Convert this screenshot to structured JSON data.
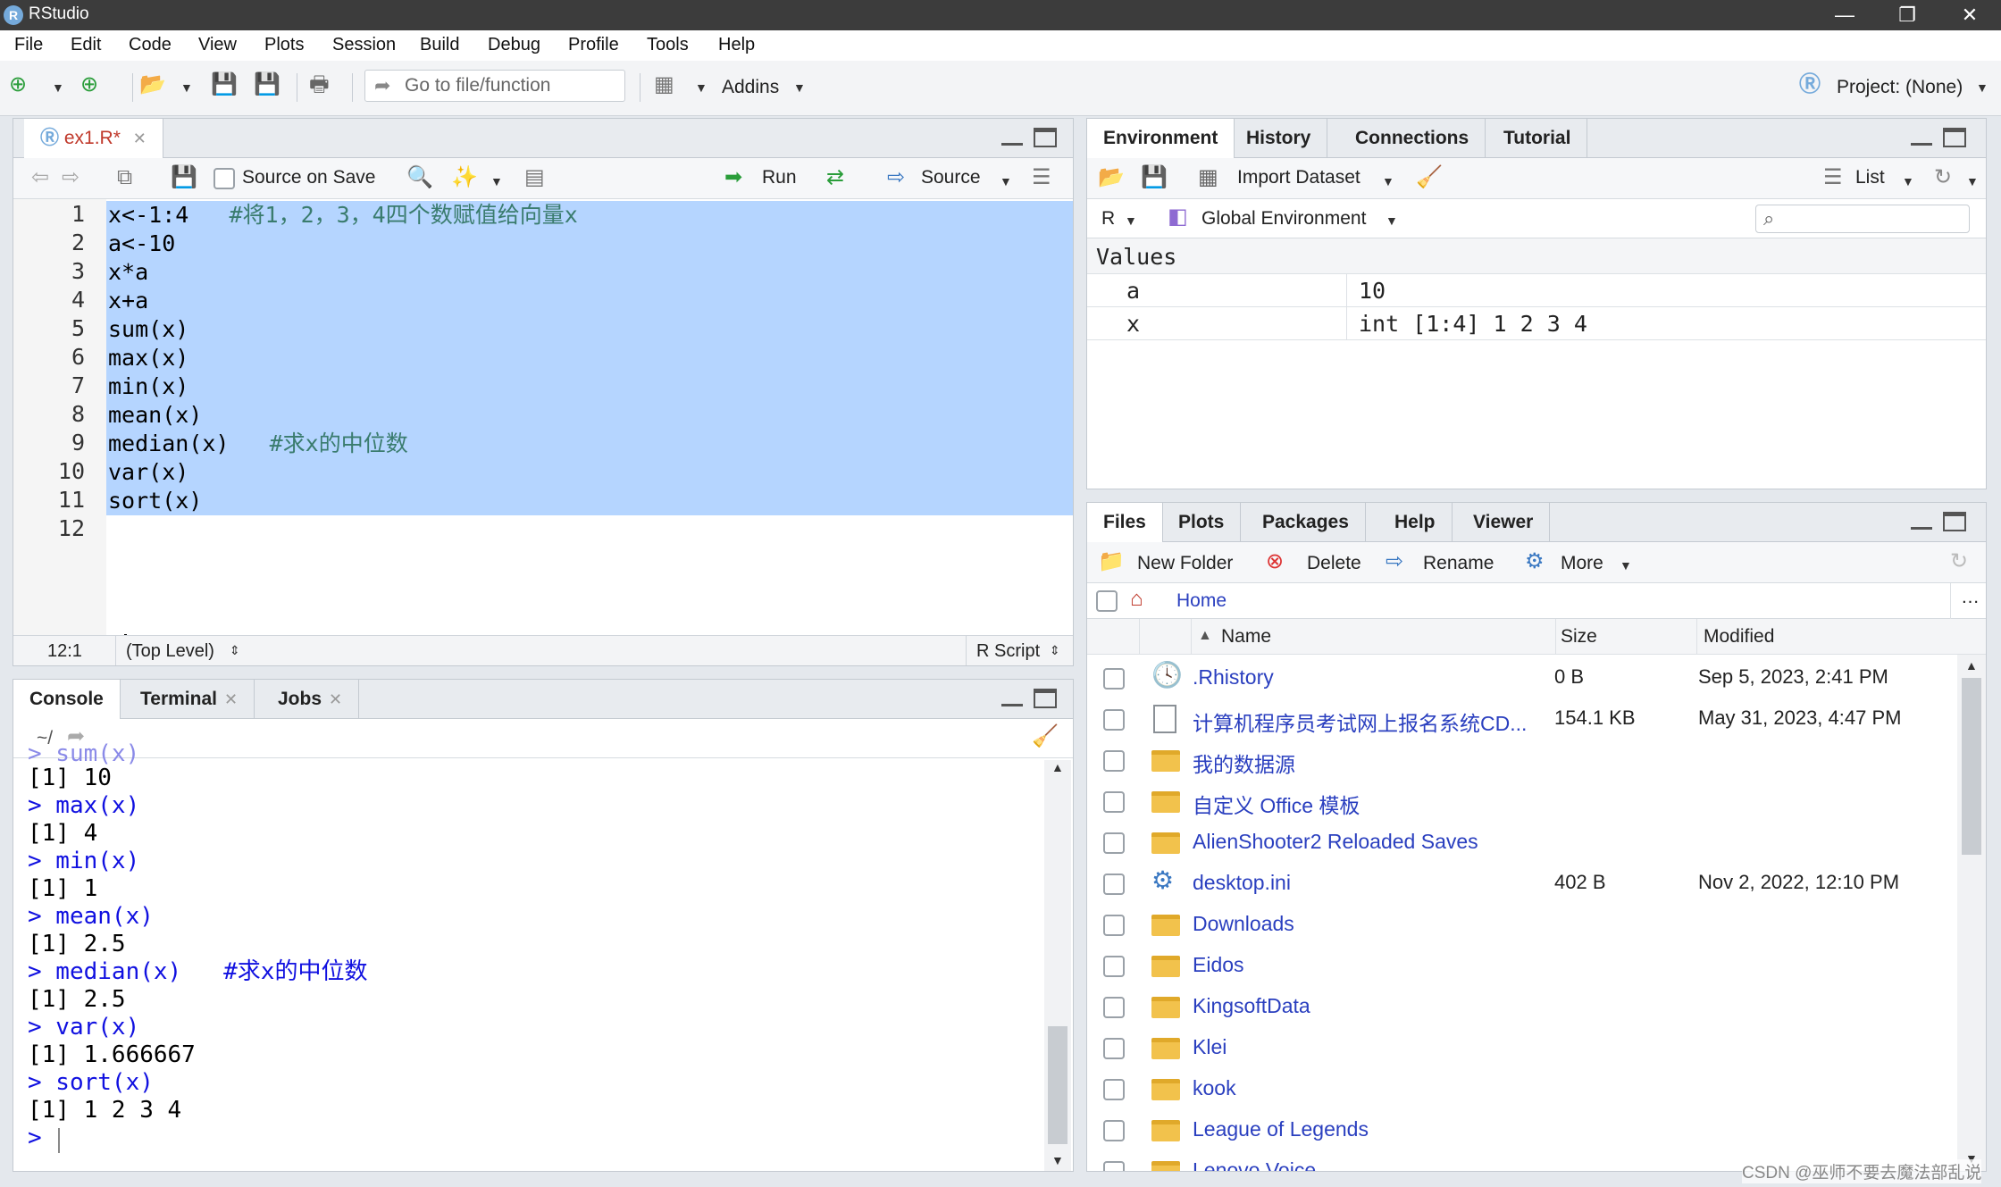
{
  "window": {
    "title": "RStudio",
    "app_icon": "R"
  },
  "menu": [
    "File",
    "Edit",
    "Code",
    "View",
    "Plots",
    "Session",
    "Build",
    "Debug",
    "Profile",
    "Tools",
    "Help"
  ],
  "toolbar": {
    "goto_placeholder": "Go to file/function",
    "addins_label": "Addins",
    "project_label": "Project: (None)"
  },
  "editor": {
    "tab_label": "ex1.R*",
    "source_on_save_label": "Source on Save",
    "run_label": "Run",
    "source_label": "Source",
    "line_numbers": [
      "1",
      "2",
      "3",
      "4",
      "5",
      "6",
      "7",
      "8",
      "9",
      "10",
      "11",
      "12"
    ],
    "lines": [
      {
        "code": "x<-1:4",
        "comment": "#将1，2，3，4四个数赋值给向量x"
      },
      {
        "code": "a<-10",
        "comment": ""
      },
      {
        "code": "x*a",
        "comment": ""
      },
      {
        "code": "x+a",
        "comment": ""
      },
      {
        "code": "sum(x)",
        "comment": ""
      },
      {
        "code": "max(x)",
        "comment": ""
      },
      {
        "code": "min(x)",
        "comment": ""
      },
      {
        "code": "mean(x)",
        "comment": ""
      },
      {
        "code": "median(x)",
        "comment": "#求x的中位数"
      },
      {
        "code": "var(x)",
        "comment": ""
      },
      {
        "code": "sort(x)",
        "comment": ""
      },
      {
        "code": "",
        "comment": ""
      }
    ],
    "status": {
      "position": "12:1",
      "scope": "(Top Level)",
      "filetype": "R Script"
    }
  },
  "console": {
    "tabs": [
      {
        "label": "Console",
        "closable": false
      },
      {
        "label": "Terminal",
        "closable": true
      },
      {
        "label": "Jobs",
        "closable": true
      }
    ],
    "path": "~/",
    "lines": [
      {
        "kind": "cmd",
        "text": "> sum(x)"
      },
      {
        "kind": "out",
        "text": "[1] 10"
      },
      {
        "kind": "cmd",
        "text": "> max(x)"
      },
      {
        "kind": "out",
        "text": "[1] 4"
      },
      {
        "kind": "cmd",
        "text": "> min(x)"
      },
      {
        "kind": "out",
        "text": "[1] 1"
      },
      {
        "kind": "cmd",
        "text": "> mean(x)"
      },
      {
        "kind": "out",
        "text": "[1] 2.5"
      },
      {
        "kind": "cmd",
        "text": "> median(x)",
        "comment": "#求x的中位数"
      },
      {
        "kind": "out",
        "text": "[1] 2.5"
      },
      {
        "kind": "cmd",
        "text": "> var(x)"
      },
      {
        "kind": "out",
        "text": "[1] 1.666667"
      },
      {
        "kind": "cmd",
        "text": "> sort(x)"
      },
      {
        "kind": "out",
        "text": "[1] 1 2 3 4"
      },
      {
        "kind": "cmd",
        "text": "> "
      }
    ]
  },
  "environment": {
    "tabs": [
      "Environment",
      "History",
      "Connections",
      "Tutorial"
    ],
    "import_label": "Import Dataset",
    "list_label": "List",
    "lang_label": "R",
    "scope_label": "Global Environment",
    "section": "Values",
    "values": [
      {
        "name": "a",
        "value": "10"
      },
      {
        "name": "x",
        "value": "int [1:4] 1 2 3 4"
      }
    ]
  },
  "files": {
    "tabs": [
      "Files",
      "Plots",
      "Packages",
      "Help",
      "Viewer"
    ],
    "new_folder_label": "New Folder",
    "delete_label": "Delete",
    "rename_label": "Rename",
    "more_label": "More",
    "home_label": "Home",
    "columns": {
      "name": "Name",
      "size": "Size",
      "modified": "Modified"
    },
    "rows": [
      {
        "type": "history",
        "name": ".Rhistory",
        "size": "0 B",
        "modified": "Sep 5, 2023, 2:41 PM"
      },
      {
        "type": "doc",
        "name": "计算机程序员考试网上报名系统CD...",
        "size": "154.1 KB",
        "modified": "May 31, 2023, 4:47 PM"
      },
      {
        "type": "folder",
        "name": "我的数据源",
        "size": "",
        "modified": ""
      },
      {
        "type": "folder",
        "name": "自定义 Office 模板",
        "size": "",
        "modified": ""
      },
      {
        "type": "folder",
        "name": "AlienShooter2 Reloaded Saves",
        "size": "",
        "modified": ""
      },
      {
        "type": "ini",
        "name": "desktop.ini",
        "size": "402 B",
        "modified": "Nov 2, 2022, 12:10 PM"
      },
      {
        "type": "folder",
        "name": "Downloads",
        "size": "",
        "modified": ""
      },
      {
        "type": "folder",
        "name": "Eidos",
        "size": "",
        "modified": ""
      },
      {
        "type": "folder",
        "name": "KingsoftData",
        "size": "",
        "modified": ""
      },
      {
        "type": "folder",
        "name": "Klei",
        "size": "",
        "modified": ""
      },
      {
        "type": "folder",
        "name": "kook",
        "size": "",
        "modified": ""
      },
      {
        "type": "folder",
        "name": "League of Legends",
        "size": "",
        "modified": ""
      },
      {
        "type": "folder",
        "name": "Lenovo Voice",
        "size": "",
        "modified": ""
      }
    ]
  },
  "watermark": "CSDN @巫师不要去魔法部乱说"
}
